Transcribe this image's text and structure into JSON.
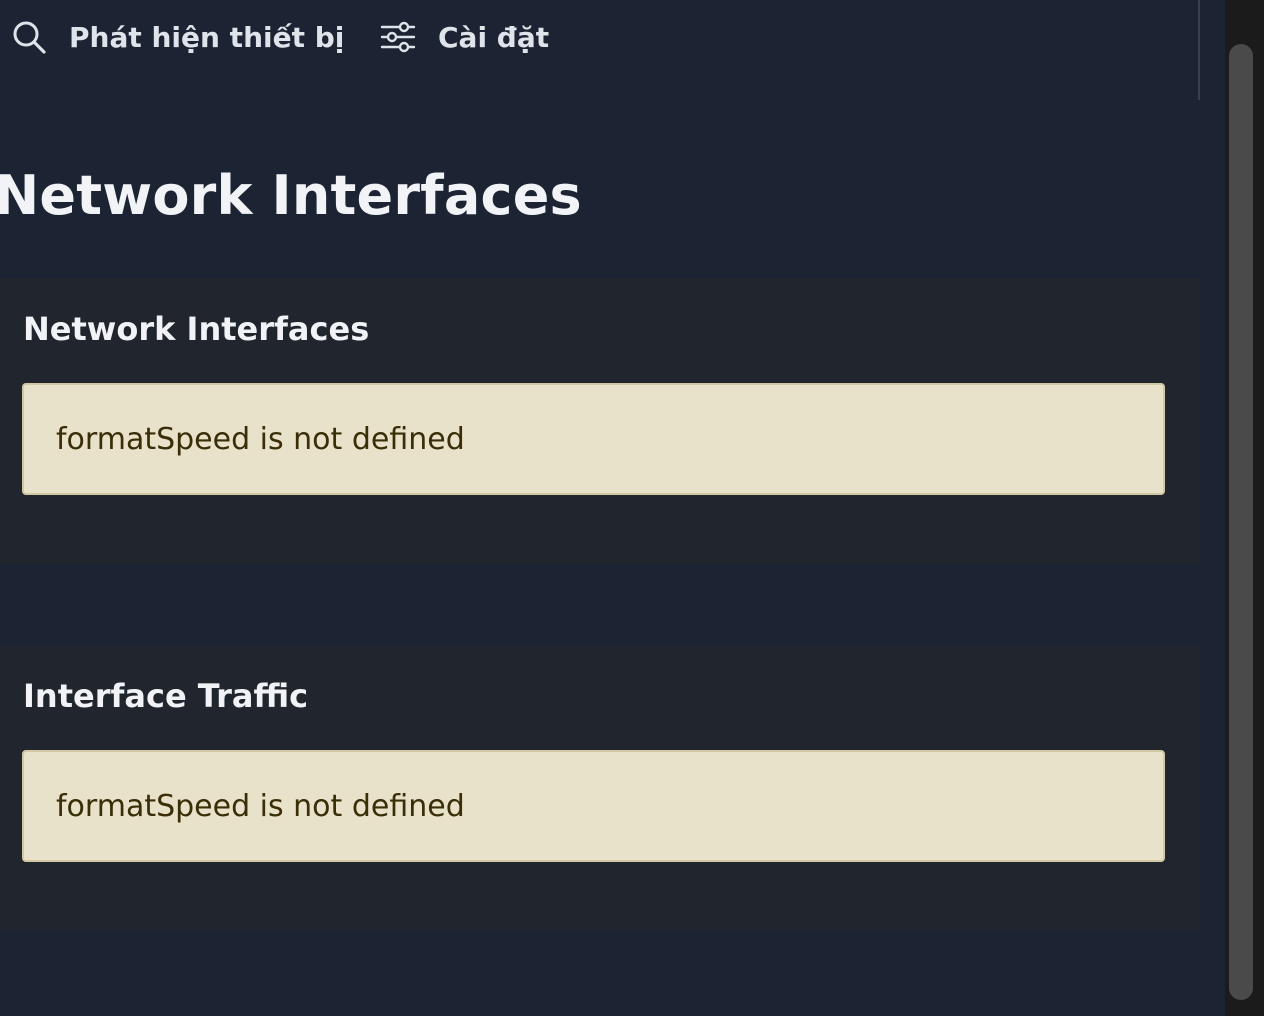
{
  "nav": {
    "discover": {
      "label": "Phát hiện thiết bị",
      "icon": "search-icon"
    },
    "settings": {
      "label": "Cài đặt",
      "icon": "sliders-icon"
    }
  },
  "page": {
    "title": "Network Interfaces"
  },
  "cards": [
    {
      "title": "Network Interfaces",
      "error": "formatSpeed is not defined"
    },
    {
      "title": "Interface Traffic",
      "error": "formatSpeed is not defined"
    }
  ],
  "colors": {
    "background": "#1c2333",
    "card": "#21252e",
    "error_background": "#e9e2cb",
    "error_text": "#3a2e08",
    "text": "#f1f3f6"
  }
}
